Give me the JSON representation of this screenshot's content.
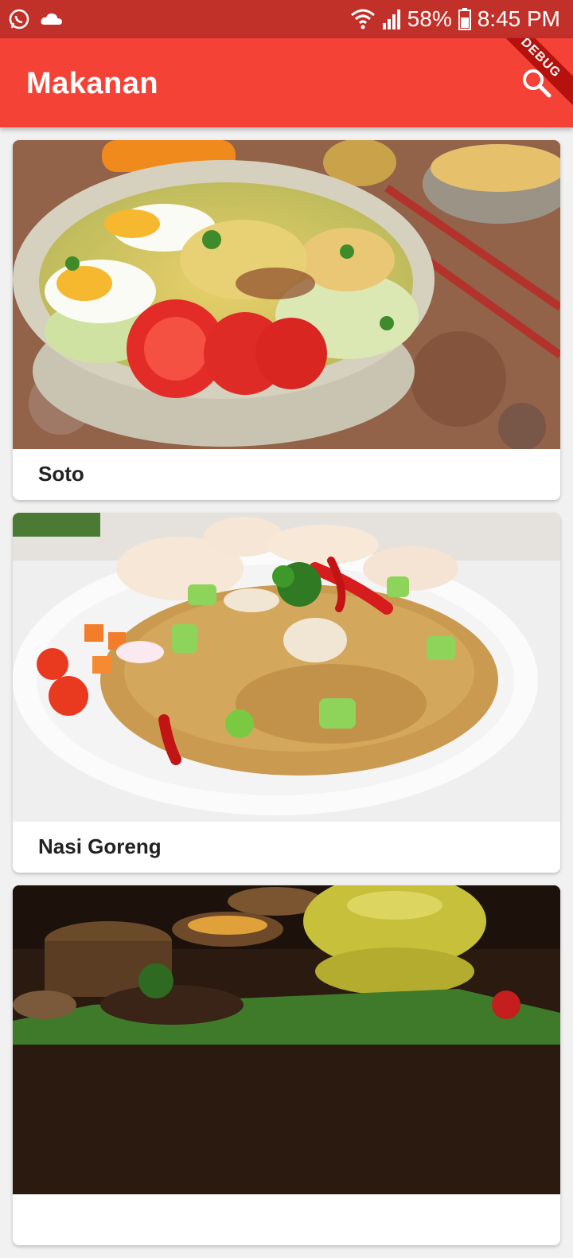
{
  "status_bar": {
    "battery": "58%",
    "time": "8:45 PM",
    "icons": [
      "whatsapp-icon",
      "cloud-icon",
      "wifi-icon",
      "signal-icon",
      "battery-icon"
    ]
  },
  "app_bar": {
    "title": "Makanan",
    "search_icon": "search-icon",
    "debug_label": "DEBUG",
    "color": "#f44336"
  },
  "foods": [
    {
      "name": "Soto"
    },
    {
      "name": "Nasi Goreng"
    },
    {
      "name": ""
    }
  ]
}
